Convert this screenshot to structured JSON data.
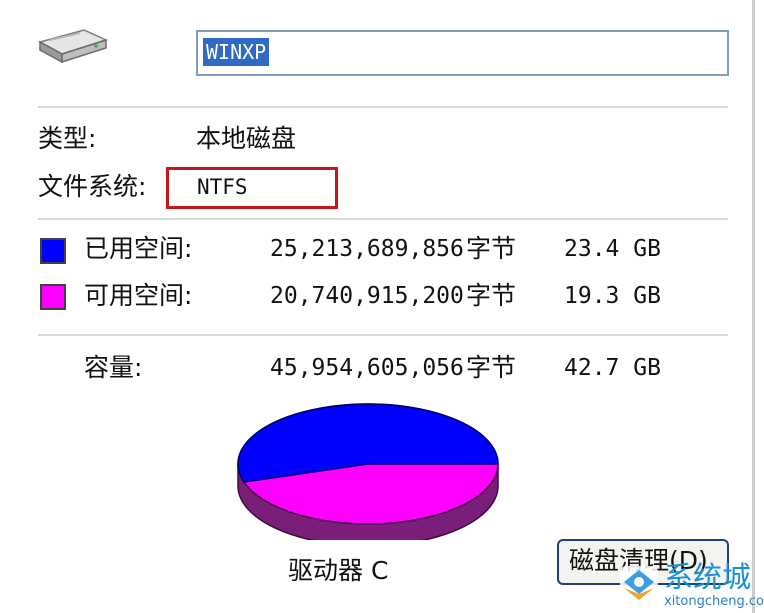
{
  "general": {
    "volume_name": "WINXP",
    "type_label": "类型:",
    "type_value": "本地磁盘",
    "fs_label": "文件系统:",
    "fs_value": "NTFS"
  },
  "space": {
    "used": {
      "label": "已用空间:",
      "bytes": "25,213,689,856",
      "unit": "字节",
      "size": "23.4 GB",
      "color": "#0000ff"
    },
    "free": {
      "label": "可用空间:",
      "bytes": "20,740,915,200",
      "unit": "字节",
      "size": "19.3 GB",
      "color": "#ff00ff"
    },
    "capacity": {
      "label": "容量:",
      "bytes": "45,954,605,056",
      "unit": "字节",
      "size": "42.7 GB"
    }
  },
  "drive_label": "驱动器 C",
  "cleanup_button": "磁盘清理(D)",
  "icons": {
    "drive": "hard-drive-icon",
    "watermark": "xitongcheng-logo-icon"
  },
  "watermark": {
    "text": "系统城",
    "url": "xitongcheng.com"
  }
}
